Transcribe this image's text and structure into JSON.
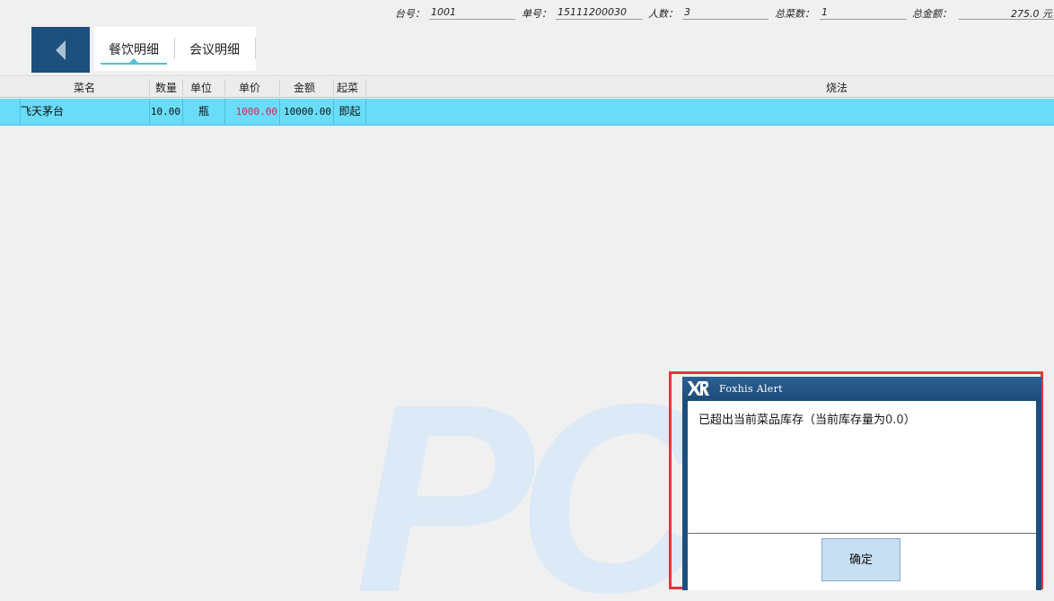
{
  "info": {
    "table_no_label": "台号：",
    "table_no": "1001",
    "bill_no_label": "单号：",
    "bill_no": "15111200030",
    "guests_label": "人数：",
    "guests": "3",
    "dish_count_label": "总菜数：",
    "dish_count": "1",
    "total_label": "总金额：",
    "total": "275.0 元"
  },
  "tabs": [
    {
      "label": "餐饮明细",
      "active": true
    },
    {
      "label": "会议明细",
      "active": false
    }
  ],
  "table": {
    "headers": [
      "菜名",
      "数量",
      "单位",
      "单价",
      "金额",
      "起菜",
      "烧法"
    ],
    "rows": [
      {
        "name": "飞天茅台",
        "qty": "10.00",
        "unit": "瓶",
        "price": "1000.00",
        "amount": "10000.00",
        "serve": "即起",
        "method": ""
      }
    ]
  },
  "watermark": "PC",
  "dialog": {
    "title": "Foxhis Alert",
    "logo": "XR",
    "message_prefix": "已超出当前菜品库存（当前库存量为",
    "message_value": "0.0",
    "message_suffix": "）",
    "ok_label": "确定"
  },
  "colors": {
    "back_button": "#1d4f7d",
    "selected_row": "#69dcf8",
    "price_text": "#e0204a",
    "dialog_frame": "#1e4e7d",
    "highlight_border": "#e0383d",
    "tab_indicator": "#4fc3d9"
  },
  "icons": {
    "back": "arrow-left-icon",
    "logo": "foxhis-logo-icon"
  }
}
